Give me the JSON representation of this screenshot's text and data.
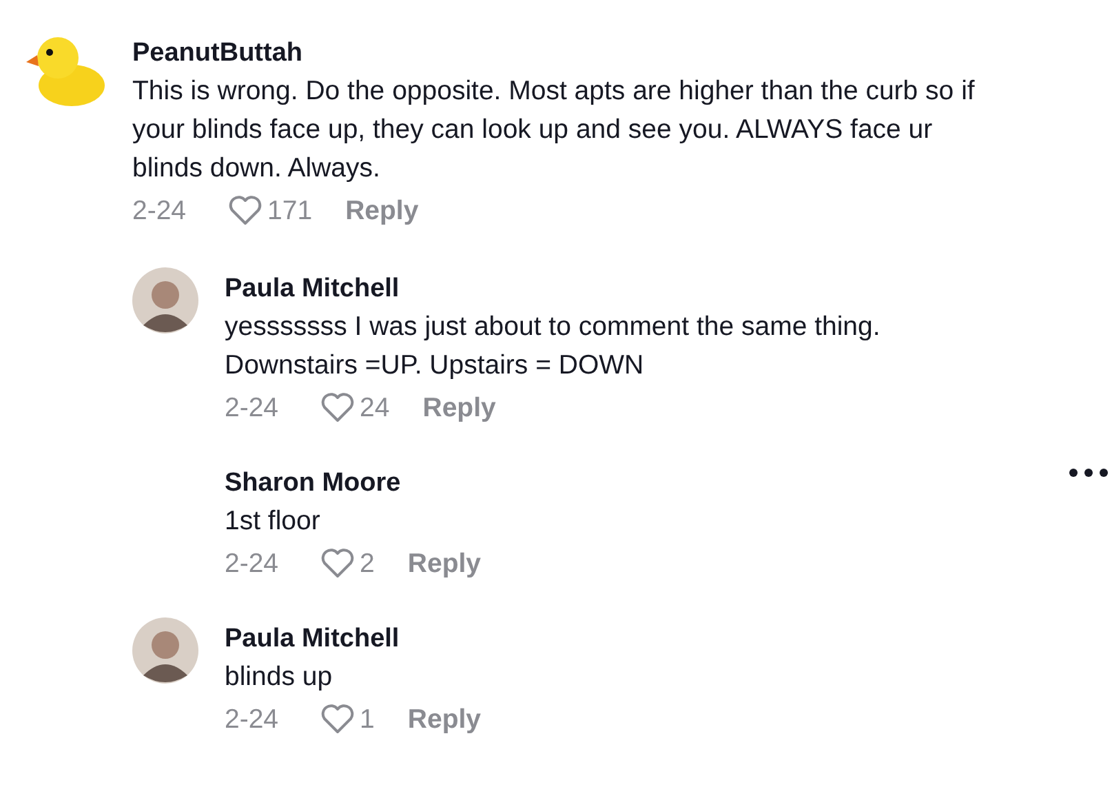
{
  "comment": {
    "avatar": {
      "kind": "duck"
    },
    "author": "PeanutButtah",
    "text": "This is wrong. Do the opposite. Most apts are higher than the curb so if\nyour blinds face up, they can look up and see you. ALWAYS face ur\nblinds down. Always.",
    "date": "2-24",
    "likes": "171",
    "reply_label": "Reply",
    "replies": [
      {
        "avatar": {
          "kind": "person"
        },
        "author": "Paula Mitchell",
        "text": "yesssssss I was just about to comment the same thing.\nDownstairs =UP. Upstairs = DOWN",
        "date": "2-24",
        "likes": "24",
        "reply_label": "Reply",
        "more_menu": false
      },
      {
        "author": "Sharon Moore",
        "text": "1st floor",
        "date": "2-24",
        "likes": "2",
        "reply_label": "Reply",
        "more_menu": true
      },
      {
        "avatar": {
          "kind": "person"
        },
        "author": "Paula Mitchell",
        "text": "blinds up",
        "date": "2-24",
        "likes": "1",
        "reply_label": "Reply",
        "more_menu": false
      }
    ]
  }
}
